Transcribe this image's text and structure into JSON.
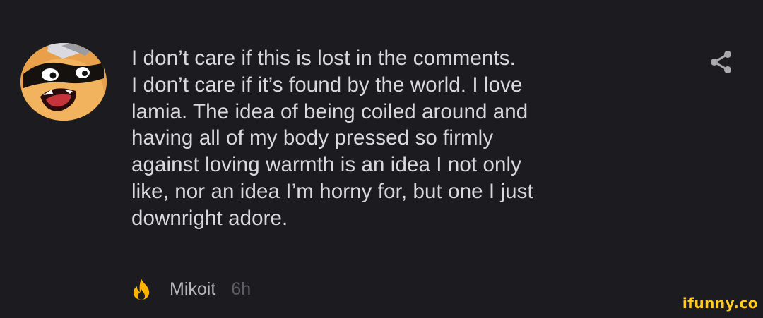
{
  "comment": {
    "avatar_icon": "cartoon-character-avatar",
    "text": "I don’t care if this is lost in the comments.\nI don’t care if it’s found by the world. I love\nlamia. The idea of being coiled around and\nhaving all of my body pressed so firmly\nagainst loving warmth is an idea I not only\nlike, nor an idea I’m horny for, but one I just\ndownright adore.",
    "share_icon": "share-icon",
    "author": "Mikoit",
    "time": "6h",
    "reaction_icon": "fire-icon"
  },
  "watermark": "ifunny.co",
  "colors": {
    "background": "#1c1c20",
    "text": "#d9d9dc",
    "author": "#b7b7bb",
    "time": "#5d5d63",
    "fire": "#ffb300",
    "share": "#a9a9ae",
    "watermark": "#ffcb26"
  }
}
